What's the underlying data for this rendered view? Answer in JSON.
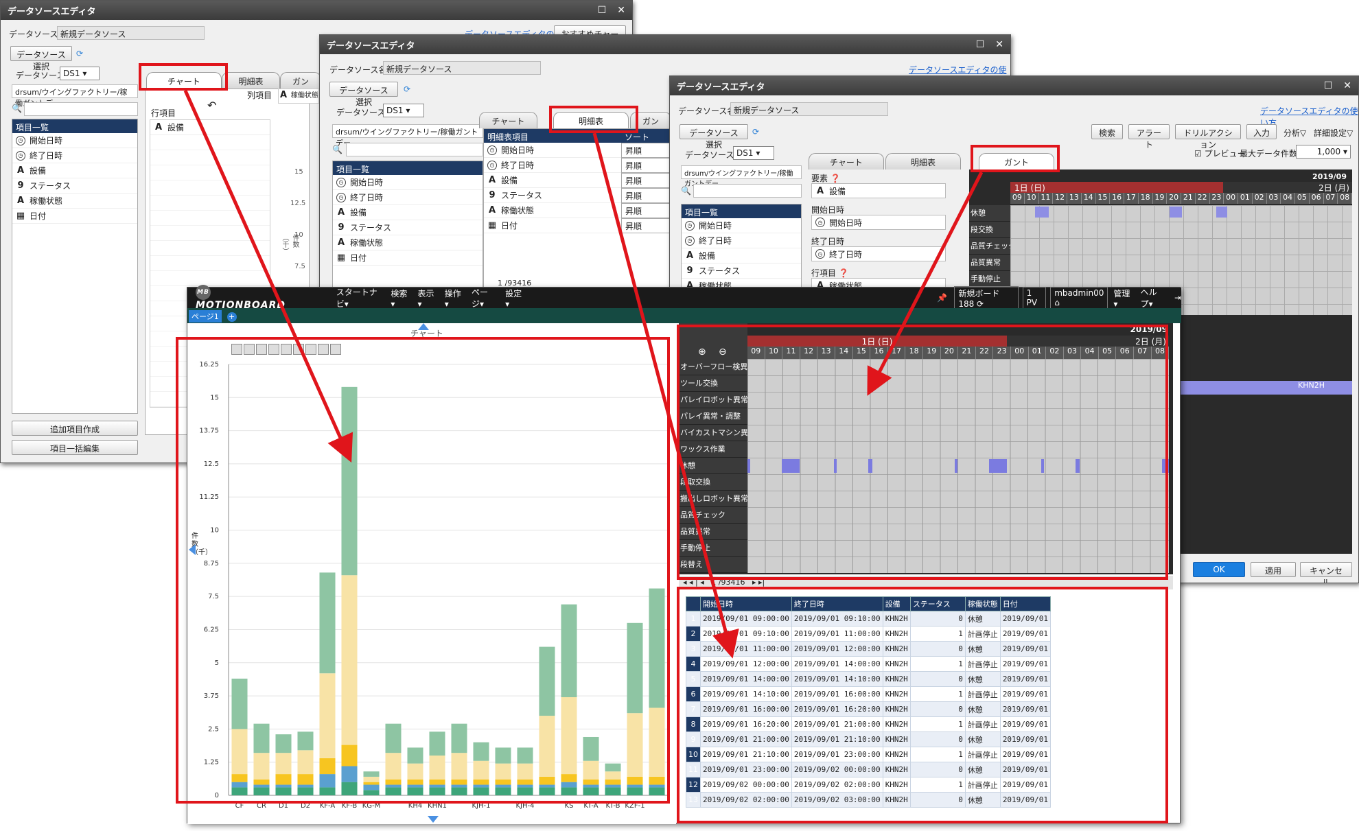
{
  "win1": {
    "title": "データソースエディタ",
    "ds_name_label": "データソース名",
    "ds_name": "新規データソース",
    "select_btn": "データソース選択",
    "ds_label": "データソース",
    "ds_value": "DS1",
    "path": "drsum/ウイングファクトリー/稼働ガントデー",
    "list_head": "項目一覧",
    "fields": [
      "開始日時",
      "終了日時",
      "設備",
      "ステータス",
      "稼働状態",
      "日付"
    ],
    "add_btn": "追加項目作成",
    "bulk_btn": "項目一括編集",
    "tabs": [
      "チャート",
      "明細表",
      "ガン"
    ],
    "row_label": "行項目",
    "col_label": "列項目",
    "row_item": "設備",
    "col_item": "稼働状態",
    "link": "データソースエディタの使い方",
    "extra_btn": "おすすめチャート",
    "axis_ticks": [
      "15",
      "12.5",
      "10",
      "7.5"
    ],
    "ylabel": "件数（千）"
  },
  "win2": {
    "title": "データソースエディタ",
    "ds_name_label": "データソース名",
    "ds_name": "新規データソース",
    "select_btn": "データソース選択",
    "ds_label": "データソース",
    "ds_value": "DS1",
    "path": "drsum/ウイングファクトリー/稼働ガントデー",
    "list_head": "項目一覧",
    "fields": [
      "開始日時",
      "終了日時",
      "設備",
      "ステータス",
      "稼働状態",
      "日付"
    ],
    "tabs": [
      "チャート",
      "明細表",
      "ガン"
    ],
    "detail_head": "明細表項目",
    "sort_head": "ソート",
    "detail_items": [
      "開始日時",
      "終了日時",
      "設備",
      "ステータス",
      "稼働状態",
      "日付"
    ],
    "sort_values": [
      "昇順",
      "昇順",
      "昇順",
      "昇順",
      "昇順",
      "昇順"
    ],
    "link": "データソースエディタの使い方",
    "pager": "1 /93416"
  },
  "win3": {
    "title": "データソースエディタ",
    "ds_name_label": "データソース名",
    "ds_name": "新規データソース",
    "select_btn": "データソース選択",
    "ds_label": "データソース",
    "ds_value": "DS1",
    "path": "drsum/ウイングファクトリー/稼働ガントデー",
    "list_head": "項目一覧",
    "fields": [
      "開始日時",
      "終了日時",
      "設備",
      "ステータス",
      "稼働状態"
    ],
    "tabs": [
      "チャート",
      "明細表",
      "ガント"
    ],
    "link": "データソースエディタの使い方",
    "top_btns": [
      "検索",
      "アラート",
      "ドリルアクション",
      "入力"
    ],
    "analysis": "分析▽",
    "detail_setting": "詳細設定▽",
    "preview": "プレビュー",
    "max_label": "最大データ件数",
    "max_value": "1,000",
    "element_label": "要素",
    "elem_item": "設備",
    "start_label": "開始日時",
    "start_item": "開始日時",
    "end_label": "終了日時",
    "end_item": "終了日時",
    "row_label": "行項目",
    "row_item": "稼働状態",
    "month": "2019/09",
    "day1": "1日 (日)",
    "day2": "2日 (月)",
    "hours": [
      "09",
      "10",
      "11",
      "12",
      "13",
      "14",
      "15",
      "16",
      "17",
      "18",
      "19",
      "20",
      "21",
      "22",
      "23",
      "00",
      "01",
      "02",
      "03",
      "04",
      "05",
      "06",
      "07",
      "08"
    ],
    "rows": [
      "休憩",
      "段交換",
      "品質チェック",
      "品質異常",
      "手動停止"
    ],
    "bar_label": "KHN2H",
    "ok": "OK",
    "apply": "適用",
    "cancel": "キャンセル"
  },
  "mb": {
    "logo": "MOTIONBOARD",
    "menus": [
      "スタートナビ▾",
      "検索▾",
      "表示▾",
      "操作▾",
      "ページ▾",
      "設定▾"
    ],
    "board": "新規ボード188",
    "pv": "1 PV",
    "user": "mbadmin00",
    "manage": "管理▾",
    "help": "ヘルプ▾",
    "page_tab": "ページ1"
  },
  "chart_data": {
    "type": "bar",
    "title": "チャート",
    "ylabel": "件数（千）",
    "ylim": [
      0,
      16.25
    ],
    "yticks": [
      "0",
      "1.25",
      "2.5",
      "3.75",
      "5",
      "6.25",
      "7.5",
      "8.75",
      "10",
      "11.25",
      "12.5",
      "13.75",
      "15",
      "16.25"
    ],
    "categories": [
      "CF",
      "CR",
      "D1",
      "D2",
      "KF-A",
      "KF-B",
      "KG-M",
      "",
      "KH4",
      "KHN1",
      "",
      "KJH-1",
      "",
      "KJH-4",
      "",
      "KS",
      "KT-A",
      "KT-B",
      "KZF-1",
      ""
    ],
    "series": [
      {
        "values": [
          0.3,
          0.3,
          0.3,
          0.3,
          0.3,
          0.5,
          0.2,
          0.3,
          0.3,
          0.3,
          0.3,
          0.3,
          0.3,
          0.3,
          0.3,
          0.3,
          0.3,
          0.3,
          0.3,
          0.3
        ]
      },
      {
        "values": [
          0.2,
          0.1,
          0.1,
          0.1,
          0.5,
          0.6,
          0.2,
          0.1,
          0.1,
          0.1,
          0.1,
          0.1,
          0.1,
          0.1,
          0.1,
          0.2,
          0.1,
          0.1,
          0.1,
          0.1
        ]
      },
      {
        "values": [
          0.3,
          0.2,
          0.4,
          0.4,
          0.6,
          0.8,
          0.1,
          0.2,
          0.2,
          0.2,
          0.2,
          0.2,
          0.2,
          0.2,
          0.3,
          0.3,
          0.2,
          0.2,
          0.3,
          0.3
        ]
      },
      {
        "values": [
          1.7,
          1.0,
          0.8,
          0.9,
          3.2,
          6.4,
          0.2,
          1.0,
          0.6,
          0.9,
          1.0,
          0.7,
          0.6,
          0.6,
          2.3,
          2.9,
          0.7,
          0.3,
          2.4,
          2.6
        ]
      },
      {
        "values": [
          1.9,
          1.1,
          0.7,
          0.7,
          3.8,
          7.1,
          0.2,
          1.1,
          0.6,
          0.9,
          1.1,
          0.7,
          0.6,
          0.6,
          2.6,
          3.5,
          0.9,
          0.3,
          3.4,
          4.5
        ]
      }
    ],
    "colors": [
      "#3ea57a",
      "#5aa0d0",
      "#f7c520",
      "#f8e3a6",
      "#8ec5a3"
    ]
  },
  "table": {
    "headers": [
      "開始日時",
      "終了日時",
      "設備",
      "ステータス",
      "稼働状態",
      "日付"
    ],
    "rows": [
      [
        "2019/09/01 09:00:00",
        "2019/09/01 09:10:00",
        "KHN2H",
        "0",
        "休憩",
        "2019/09/01"
      ],
      [
        "2019/09/01 09:10:00",
        "2019/09/01 11:00:00",
        "KHN2H",
        "1",
        "計画停止",
        "2019/09/01"
      ],
      [
        "2019/09/01 11:00:00",
        "2019/09/01 12:00:00",
        "KHN2H",
        "0",
        "休憩",
        "2019/09/01"
      ],
      [
        "2019/09/01 12:00:00",
        "2019/09/01 14:00:00",
        "KHN2H",
        "1",
        "計画停止",
        "2019/09/01"
      ],
      [
        "2019/09/01 14:00:00",
        "2019/09/01 14:10:00",
        "KHN2H",
        "0",
        "休憩",
        "2019/09/01"
      ],
      [
        "2019/09/01 14:10:00",
        "2019/09/01 16:00:00",
        "KHN2H",
        "1",
        "計画停止",
        "2019/09/01"
      ],
      [
        "2019/09/01 16:00:00",
        "2019/09/01 16:20:00",
        "KHN2H",
        "0",
        "休憩",
        "2019/09/01"
      ],
      [
        "2019/09/01 16:20:00",
        "2019/09/01 21:00:00",
        "KHN2H",
        "1",
        "計画停止",
        "2019/09/01"
      ],
      [
        "2019/09/01 21:00:00",
        "2019/09/01 21:10:00",
        "KHN2H",
        "0",
        "休憩",
        "2019/09/01"
      ],
      [
        "2019/09/01 21:10:00",
        "2019/09/01 23:00:00",
        "KHN2H",
        "1",
        "計画停止",
        "2019/09/01"
      ],
      [
        "2019/09/01 23:00:00",
        "2019/09/02 00:00:00",
        "KHN2H",
        "0",
        "休憩",
        "2019/09/01"
      ],
      [
        "2019/09/02 00:00:00",
        "2019/09/02 02:00:00",
        "KHN2H",
        "1",
        "計画停止",
        "2019/09/01"
      ],
      [
        "2019/09/02 02:00:00",
        "2019/09/02 03:00:00",
        "KHN2H",
        "0",
        "休憩",
        "2019/09/01"
      ]
    ]
  },
  "gantt_mb": {
    "month": "2019/09",
    "day1": "1日 (日)",
    "day2": "2日 (月)",
    "hours": [
      "09",
      "10",
      "11",
      "12",
      "13",
      "14",
      "15",
      "16",
      "17",
      "18",
      "19",
      "20",
      "21",
      "22",
      "23",
      "00",
      "01",
      "02",
      "03",
      "04",
      "05",
      "06",
      "07",
      "08"
    ],
    "rows": [
      "オーバーフロー検異常",
      "ツール交換",
      "パレイロボット異常",
      "パレイ異常・調整",
      "バイカストマシン異常",
      "ワックス作業",
      "休憩",
      "段取交換",
      "搬出しロボット異常",
      "品質チェック",
      "品質異常",
      "手動停止",
      "段替え"
    ],
    "pager": "1 /93416"
  }
}
